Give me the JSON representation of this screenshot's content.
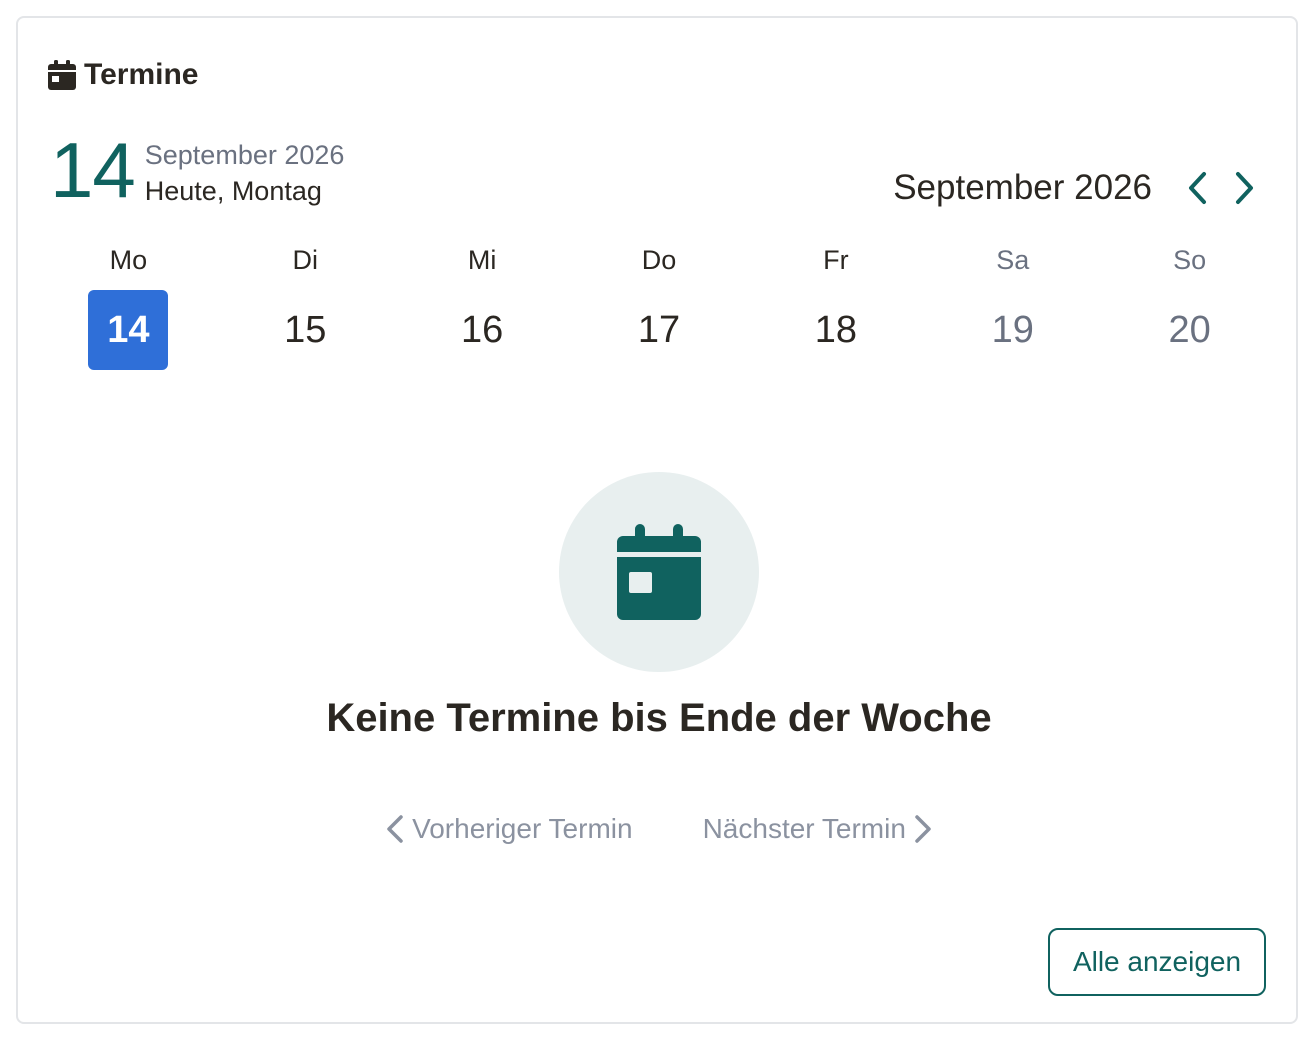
{
  "header": {
    "title": "Termine",
    "icon": "calendar-icon"
  },
  "today": {
    "day": "14",
    "month_year": "September 2026",
    "label": "Heute, Montag"
  },
  "calendar": {
    "month_label": "September 2026",
    "prev_icon": "chevron-left-icon",
    "next_icon": "chevron-right-icon",
    "week": [
      {
        "name": "Mo",
        "num": "14",
        "selected": true,
        "weekend": false
      },
      {
        "name": "Di",
        "num": "15",
        "selected": false,
        "weekend": false
      },
      {
        "name": "Mi",
        "num": "16",
        "selected": false,
        "weekend": false
      },
      {
        "name": "Do",
        "num": "17",
        "selected": false,
        "weekend": false
      },
      {
        "name": "Fr",
        "num": "18",
        "selected": false,
        "weekend": false
      },
      {
        "name": "Sa",
        "num": "19",
        "selected": false,
        "weekend": true
      },
      {
        "name": "So",
        "num": "20",
        "selected": false,
        "weekend": true
      }
    ]
  },
  "empty_state": {
    "icon": "calendar-icon",
    "message": "Keine Termine bis Ende der Woche"
  },
  "pager": {
    "prev_label": "Vorheriger Termin",
    "next_label": "Nächster Termin"
  },
  "actions": {
    "show_all_label": "Alle anzeigen"
  },
  "colors": {
    "accent": "#10625f",
    "selected_day": "#2f6fd8",
    "muted": "#6a7180",
    "disabled": "#8b92a0",
    "text": "#2b2722",
    "empty_circle": "#e8efef"
  }
}
